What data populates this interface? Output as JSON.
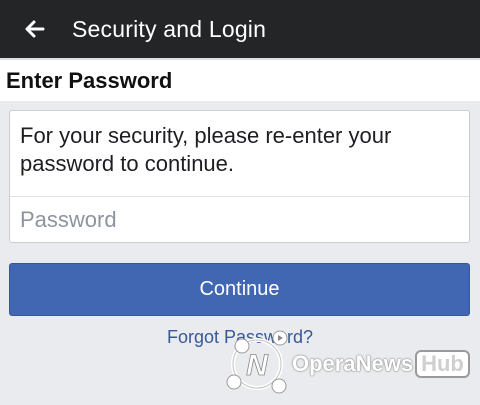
{
  "header": {
    "title": "Security and Login",
    "back_icon": "arrow-left-icon"
  },
  "section": {
    "heading": "Enter Password"
  },
  "card": {
    "message": "For your security, please re-enter your password to continue.",
    "password_placeholder": "Password",
    "password_value": ""
  },
  "actions": {
    "continue_label": "Continue",
    "forgot_label": "Forgot Password?"
  },
  "watermark": {
    "brand": "OperaNews",
    "hub": "Hub"
  },
  "colors": {
    "topbar": "#242526",
    "primary_button": "#4267b2",
    "link": "#385898",
    "page_background": "#e9ebee"
  }
}
